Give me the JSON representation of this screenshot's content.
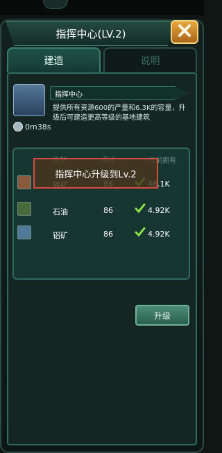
{
  "title": "指挥中心(LV.2)",
  "tabs": [
    "建造",
    "说明"
  ],
  "building": {
    "name": "指挥中心",
    "description": "提供所有资源600的产量和6.3K的容量，升级后可建造更高等级的基地建筑",
    "time": "0m38s"
  },
  "requirements": {
    "headers": [
      "类型",
      "需求",
      "当前拥有"
    ],
    "rows": [
      {
        "name": "铁矿",
        "required": "86",
        "have": "48.1K"
      },
      {
        "name": "石油",
        "required": "86",
        "have": "4.92K"
      },
      {
        "name": "铝矿",
        "required": "86",
        "have": "4.92K"
      }
    ]
  },
  "banner": "指挥中心升级到Lv.2",
  "upgrade_label": "升级",
  "icons": {
    "close": "close-x-icon",
    "timer": "stopwatch-icon",
    "check": "checkmark-icon",
    "building": "building-icon"
  }
}
